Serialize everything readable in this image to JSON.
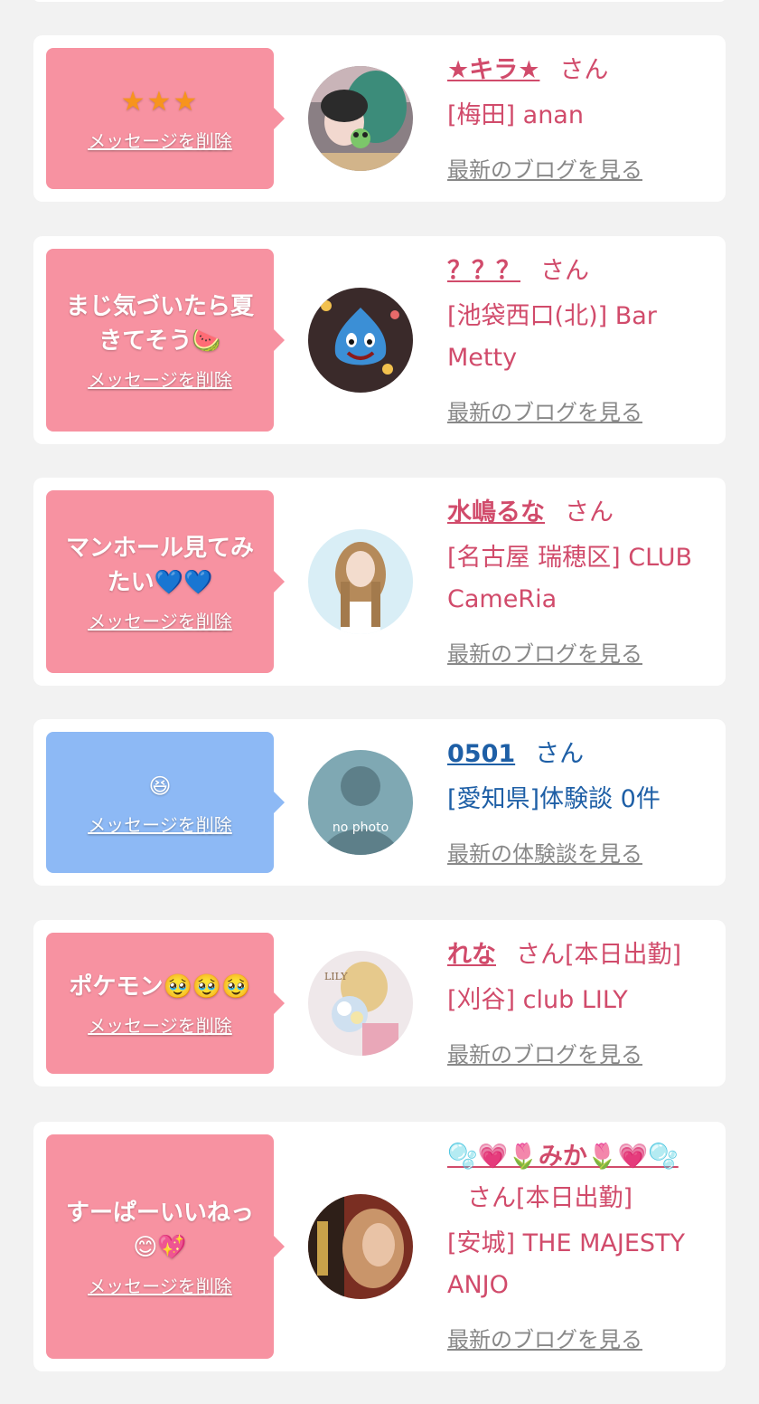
{
  "delete_label": "メッセージを削除",
  "items": [
    {
      "message": "★★★",
      "name": "★キラ★",
      "honorific": "さん",
      "shop": "[梅田] anan",
      "blog_link": "最新のブログを見る",
      "theme": "pink"
    },
    {
      "message": "まじ気づいたら夏きてそう🍉",
      "name": "？？？",
      "honorific": "さん",
      "shop": "[池袋西口(北)] Bar Metty",
      "blog_link": "最新のブログを見る",
      "theme": "pink"
    },
    {
      "message": "マンホール見てみたい💙💙",
      "name": "水嶋るな",
      "honorific": "さん",
      "shop": "[名古屋 瑞穂区] CLUB CameRia",
      "blog_link": "最新のブログを見る",
      "theme": "pink"
    },
    {
      "message": "😆",
      "name": "0501",
      "honorific": "さん",
      "shop": "[愛知県]体験談 0件",
      "blog_link": "最新の体験談を見る",
      "avatar_text": "no photo",
      "theme": "blue"
    },
    {
      "message": "ポケモン🥹🥹🥹",
      "name": "れな",
      "honorific": "さん[本日出勤]",
      "shop": "[刈谷] club LILY",
      "blog_link": "最新のブログを見る",
      "avatar_text": "LILY",
      "theme": "pink"
    },
    {
      "message": "すーぱーいいねっ😊💖",
      "name": "🫧💗🌷みか🌷💗🫧",
      "honorific": "さん[本日出勤]",
      "shop": "[安城] THE MAJESTY ANJO",
      "blog_link": "最新のブログを見る",
      "theme": "pink"
    }
  ]
}
